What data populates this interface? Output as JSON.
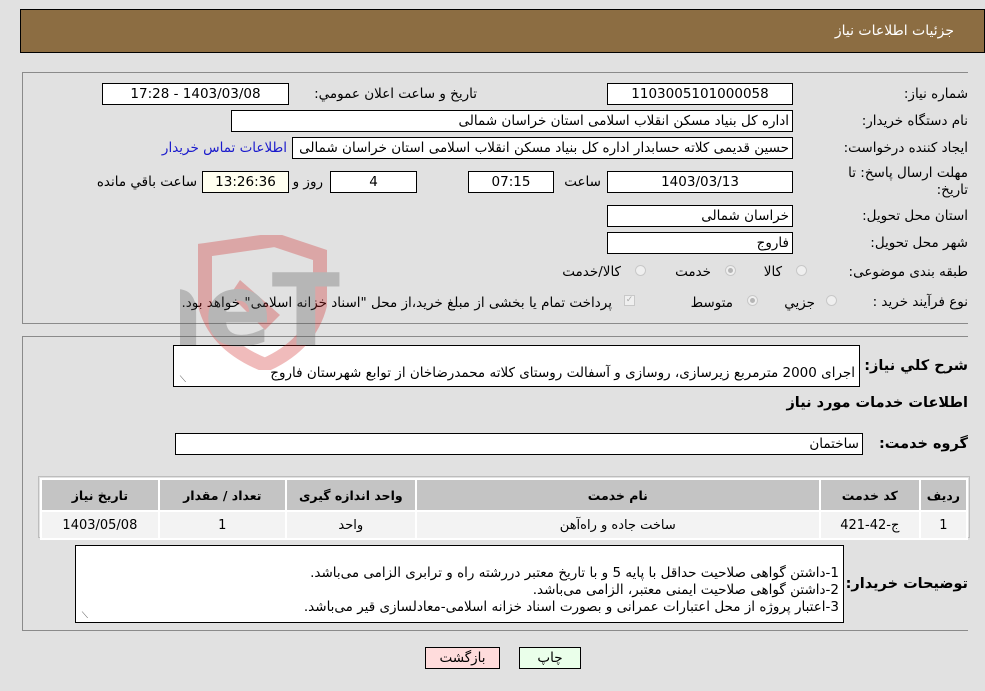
{
  "header": {
    "title": "جزئیات اطلاعات نیاز"
  },
  "form": {
    "need_number": {
      "label": "شماره نیاز:",
      "value": "1103005101000058"
    },
    "announce_datetime": {
      "label": "تاريخ و ساعت اعلان عمومي:",
      "value": "1403/03/08 - 17:28"
    },
    "buyer_org": {
      "label": "نام دستگاه خریدار:",
      "value": "اداره کل بنیاد مسکن انقلاب اسلامی استان خراسان شمالی"
    },
    "requester": {
      "label": "ایجاد کننده درخواست:",
      "value": "حسین قدیمی کلاته حسابدار اداره کل بنیاد مسکن انقلاب اسلامی استان خراسان شمالی"
    },
    "buyer_contact_link": "اطلاعات تماس خریدار",
    "deadline": {
      "label": "مهلت ارسال پاسخ: تا تاریخ:",
      "date": "1403/03/13",
      "time_label": "ساعت",
      "time": "07:15",
      "days": "4",
      "days_label": "روز و",
      "remaining": "13:26:36",
      "remaining_label": "ساعت باقي مانده"
    },
    "delivery_province": {
      "label": "استان محل تحویل:",
      "value": "خراسان شمالی"
    },
    "delivery_city": {
      "label": "شهر محل تحویل:",
      "value": "فاروج"
    },
    "category": {
      "label": "طبقه بندی موضوعی:",
      "options": [
        "کالا",
        "خدمت",
        "کالا/خدمت"
      ],
      "selected": "خدمت"
    },
    "purchase_process": {
      "label": "نوع فرآیند خرید :",
      "options": [
        "جزيي",
        "متوسط"
      ],
      "selected": "متوسط",
      "treasury_checkbox_label": "پرداخت تمام یا بخشی از مبلغ خرید،از محل \"اسناد خزانه اسلامی\" خواهد بود.",
      "treasury_checked": true
    }
  },
  "description": {
    "label": "شرح کلي نياز:",
    "value": "اجرای 2000 مترمربع زیرسازی، روسازی و آسفالت روستای کلاته محمدرضاخان از توابع شهرستان فاروج"
  },
  "services_section": {
    "title": "اطلاعات خدمات مورد نیاز",
    "service_group": {
      "label": "گروه خدمت:",
      "value": "ساختمان"
    },
    "table": {
      "columns": [
        "ردیف",
        "کد خدمت",
        "نام خدمت",
        "واحد اندازه گیری",
        "تعداد / مقدار",
        "تاریخ نیاز"
      ],
      "rows": [
        [
          "1",
          "ج-42-421",
          "ساخت جاده و راه‌آهن",
          "واحد",
          "1",
          "1403/05/08"
        ]
      ]
    }
  },
  "buyer_notes": {
    "label": "توضیحات خریدار:",
    "value": "1-داشتن گواهی صلاحیت حداقل با پایه 5 و با تاریخ معتبر دررشته راه و ترابری الزامی می‌باشد.\n2-داشتن گواهی صلاحیت ایمنی معتبر، الزامی می‌باشد.\n3-اعتبار پروژه از محل اعتبارات عمرانی و بصورت اسناد خزانه اسلامی-معادلسازی قیر می‌باشد."
  },
  "buttons": {
    "print": "چاپ",
    "back": "بازگشت"
  },
  "watermark": {
    "text": "AriaTender.neT"
  }
}
